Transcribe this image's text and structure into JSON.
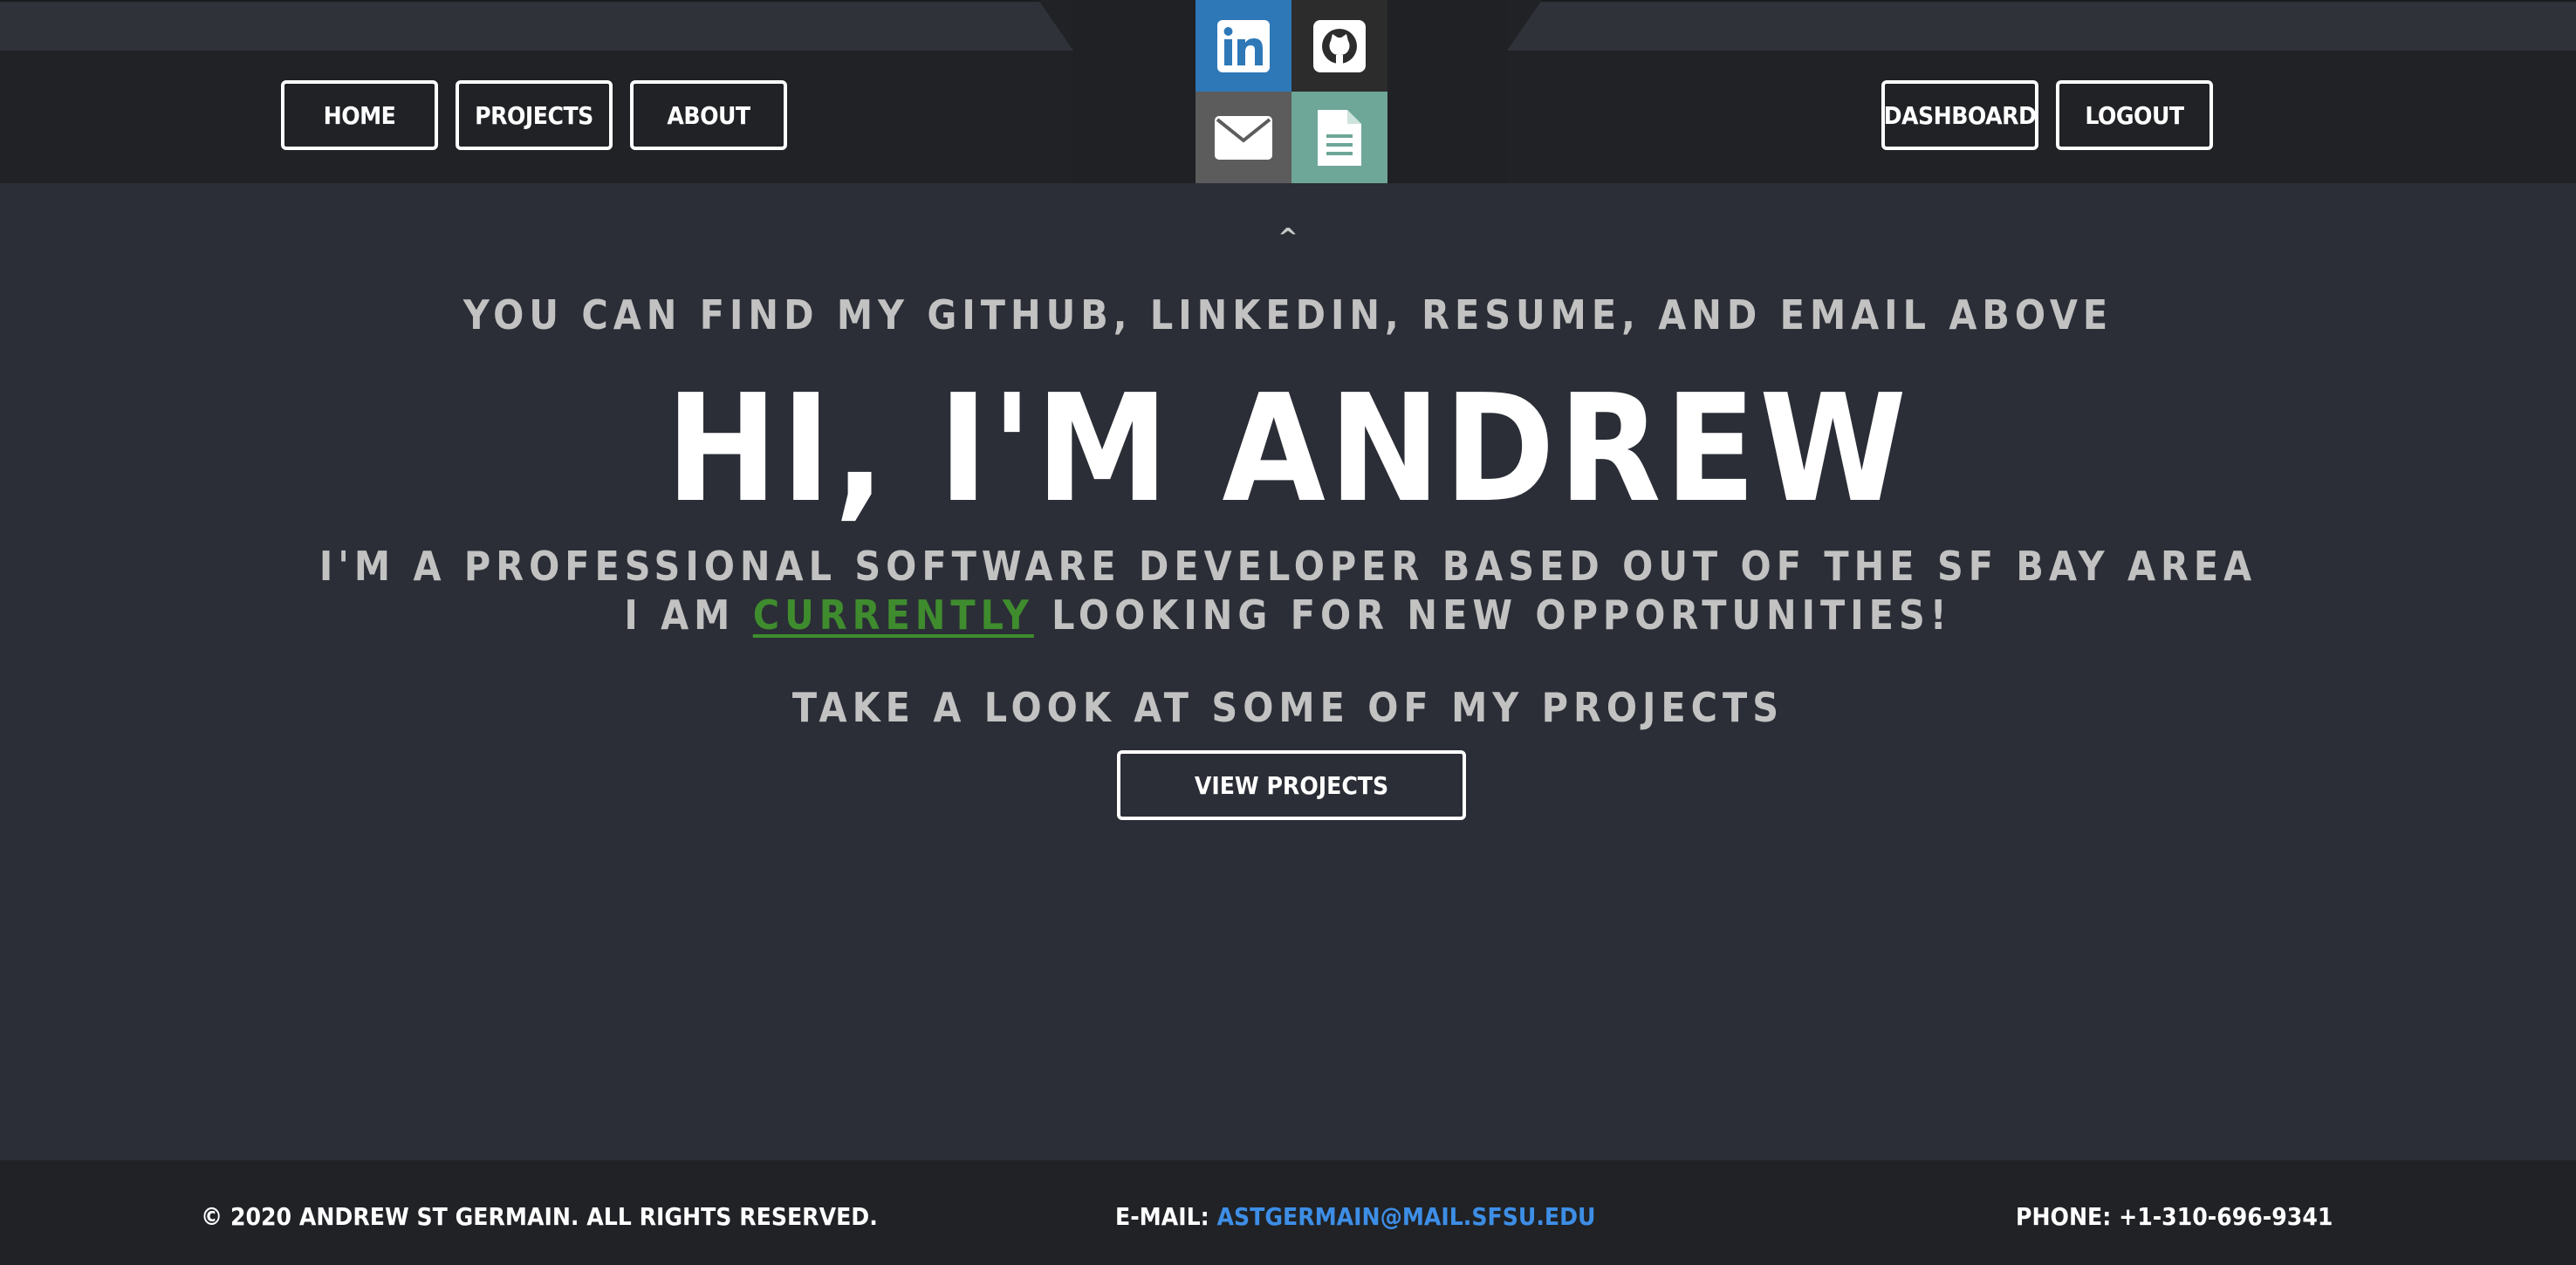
{
  "nav": {
    "home": "HOME",
    "projects": "PROJECTS",
    "about": "ABOUT",
    "dashboard": "DASHBOARD",
    "logout": "LOGOUT"
  },
  "social": [
    {
      "name": "linkedin",
      "icon": "linkedin-icon",
      "color": "#2e78b8"
    },
    {
      "name": "github",
      "icon": "github-icon",
      "color": "#2c2c2c"
    },
    {
      "name": "email",
      "icon": "envelope-icon",
      "color": "#5c5c5c"
    },
    {
      "name": "resume",
      "icon": "document-icon",
      "color": "#6ea697"
    }
  ],
  "hero": {
    "caret": "^",
    "find_line": "YOU CAN FIND MY GITHUB, LINKEDIN, RESUME, AND EMAIL ABOVE",
    "title": "HI, I'M ANDREW",
    "intro": "I'M A PROFESSIONAL SOFTWARE DEVELOPER BASED OUT OF THE SF BAY AREA",
    "status_prefix": "I AM ",
    "status_highlight": "CURRENTLY",
    "status_suffix": " LOOKING FOR NEW OPPORTUNITIES!",
    "highlight_color": "#3f8c2e",
    "projects_prompt": "TAKE A LOOK AT SOME OF MY PROJECTS",
    "view_projects": "VIEW PROJECTS"
  },
  "footer": {
    "copyright": "© 2020 ANDREW ST GERMAIN. ALL RIGHTS RESERVED.",
    "email_label": "E-MAIL: ",
    "email": "ASTGERMAIN@MAIL.SFSU.EDU",
    "phone": "PHONE: +1-310-696-9341"
  },
  "colors": {
    "background": "#2b2e36",
    "header": "#202226",
    "link": "#3d8ee6"
  }
}
